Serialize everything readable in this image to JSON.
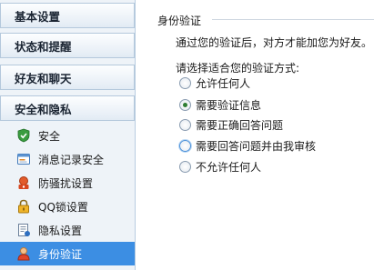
{
  "sidebar": {
    "categories": [
      {
        "label": "基本设置"
      },
      {
        "label": "状态和提醒"
      },
      {
        "label": "好友和聊天"
      },
      {
        "label": "安全和隐私"
      }
    ],
    "sub_items": [
      {
        "label": "安全",
        "icon": "shield-icon"
      },
      {
        "label": "消息记录安全",
        "icon": "message-log-icon"
      },
      {
        "label": "防骚扰设置",
        "icon": "anti-harass-icon"
      },
      {
        "label": "QQ锁设置",
        "icon": "lock-icon"
      },
      {
        "label": "隐私设置",
        "icon": "privacy-document-icon"
      },
      {
        "label": "身份验证",
        "icon": "user-icon"
      }
    ],
    "selected": "身份验证"
  },
  "main": {
    "section_title": "身份验证",
    "description": "通过您的验证后，对方才能加您为好友。",
    "prompt": "请选择适合您的验证方式:",
    "options": [
      {
        "label": "允许任何人",
        "checked": false
      },
      {
        "label": "需要验证信息",
        "checked": true
      },
      {
        "label": "需要正确回答问题",
        "checked": false
      },
      {
        "label": "需要回答问题并由我审核",
        "checked": false
      },
      {
        "label": "不允许任何人",
        "checked": false
      }
    ]
  },
  "colors": {
    "selected_bg": "#3c8ee3",
    "sidebar_bg": "#eef3f8",
    "radio_dot": "#2e7d32"
  }
}
